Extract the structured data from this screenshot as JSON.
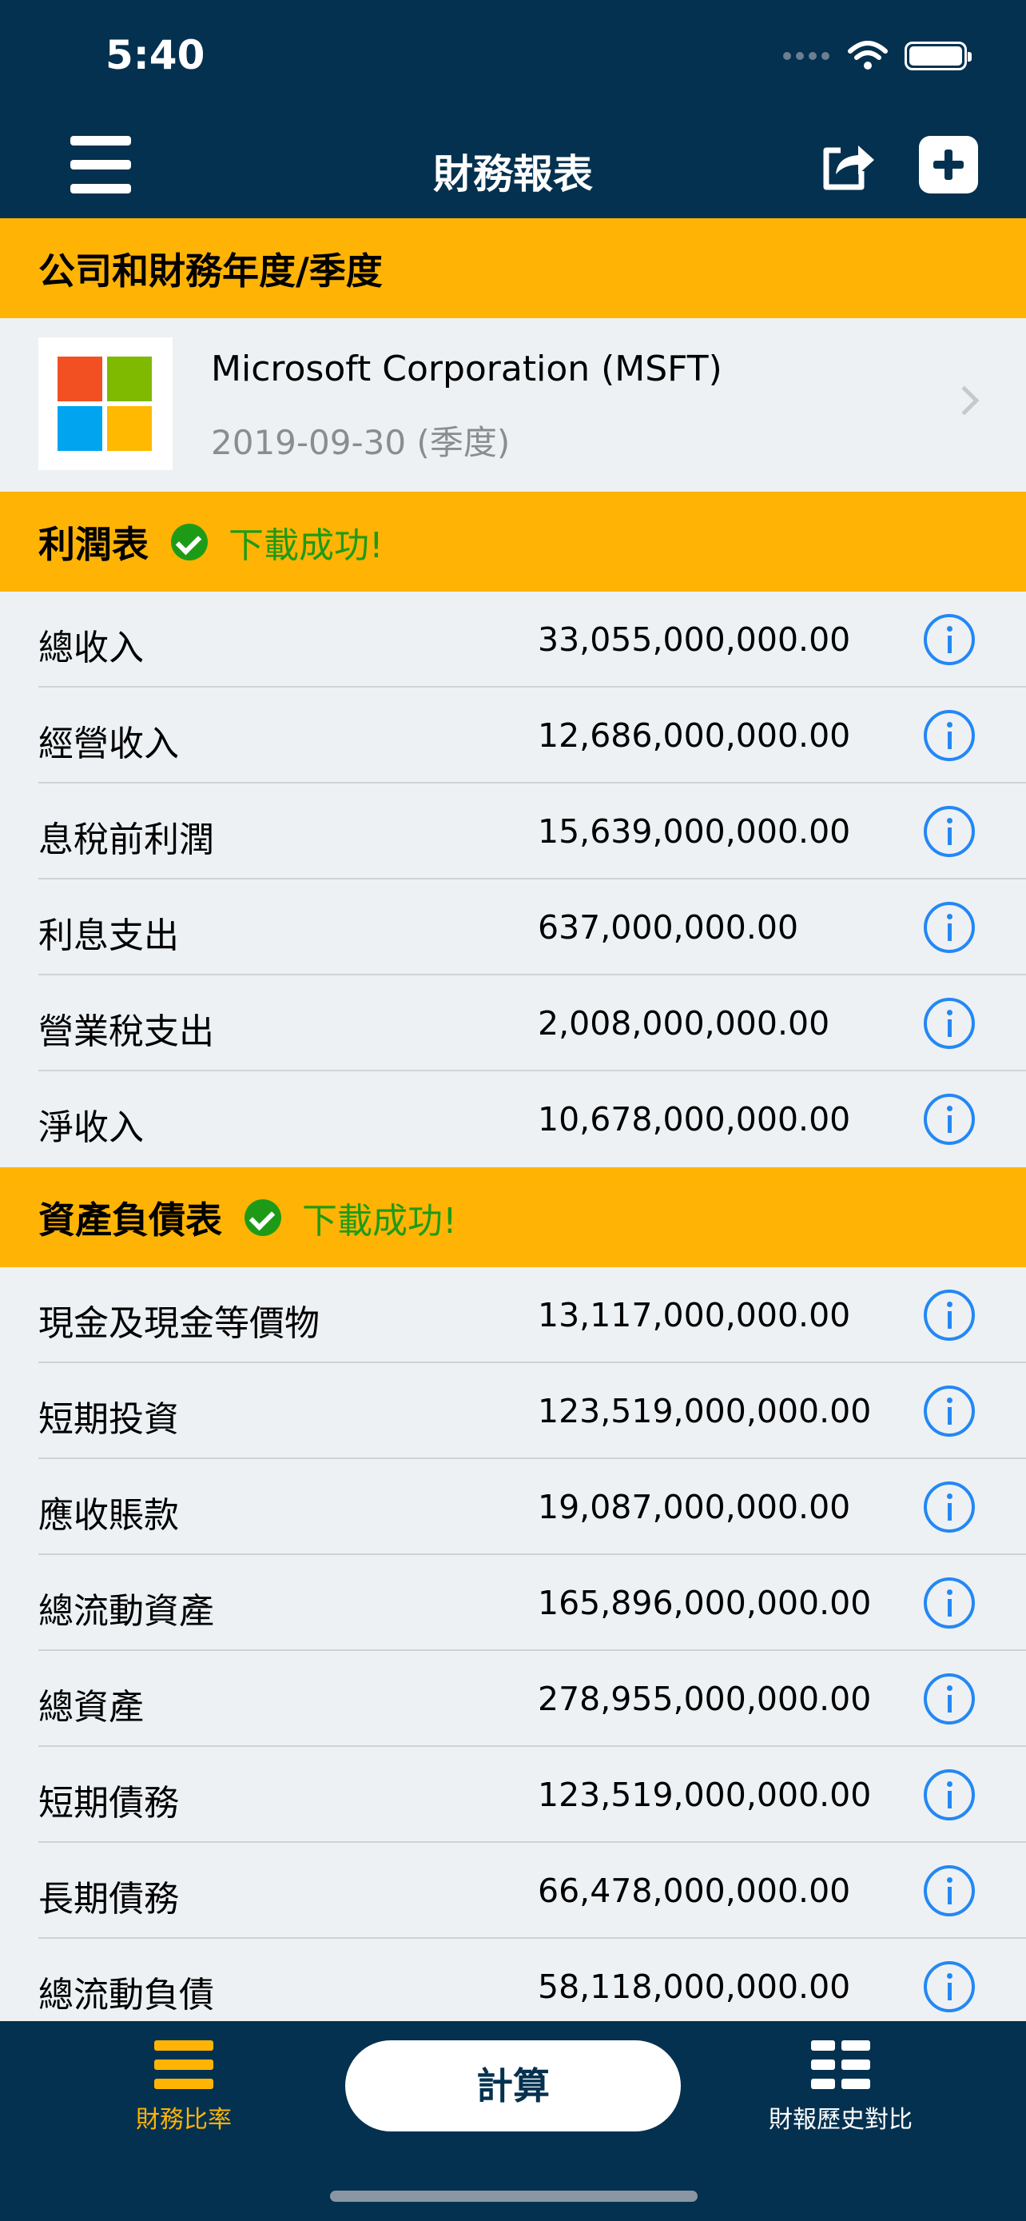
{
  "status_bar": {
    "time": "5:40"
  },
  "nav": {
    "title": "財務報表"
  },
  "company_section": {
    "title": "公司和財務年度/季度",
    "company_name": "Microsoft Corporation (MSFT)",
    "period": "2019-09-30 (季度)"
  },
  "income_statement": {
    "title": "利潤表",
    "status": "下載成功!",
    "rows": [
      {
        "label": "總收入",
        "value": "33,055,000,000.00"
      },
      {
        "label": "經營收入",
        "value": "12,686,000,000.00"
      },
      {
        "label": "息稅前利潤",
        "value": "15,639,000,000.00"
      },
      {
        "label": "利息支出",
        "value": "637,000,000.00"
      },
      {
        "label": "營業稅支出",
        "value": "2,008,000,000.00"
      },
      {
        "label": "淨收入",
        "value": "10,678,000,000.00"
      }
    ]
  },
  "balance_sheet": {
    "title": "資產負債表",
    "status": "下載成功!",
    "rows": [
      {
        "label": "現金及現金等價物",
        "value": "13,117,000,000.00"
      },
      {
        "label": "短期投資",
        "value": "123,519,000,000.00"
      },
      {
        "label": "應收賬款",
        "value": "19,087,000,000.00"
      },
      {
        "label": "總流動資產",
        "value": "165,896,000,000.00"
      },
      {
        "label": "總資產",
        "value": "278,955,000,000.00"
      },
      {
        "label": "短期債務",
        "value": "123,519,000,000.00"
      },
      {
        "label": "長期債務",
        "value": "66,478,000,000.00"
      },
      {
        "label": "總流動負債",
        "value": "58,118,000,000.00"
      }
    ]
  },
  "tabbar": {
    "left_label": "財務比率",
    "center_button": "計算",
    "right_label": "財報歷史對比"
  },
  "colors": {
    "navy": "#04314f",
    "accent_orange": "#ffb405",
    "success_green": "#1e9b16",
    "info_blue": "#2487f5"
  },
  "icons": {
    "menu": "menu-icon",
    "share": "share-icon",
    "add": "plus-square-icon",
    "info": "info-icon",
    "check": "check-circle-icon",
    "ratios_tab": "list-icon",
    "history_tab": "grid-list-icon"
  }
}
